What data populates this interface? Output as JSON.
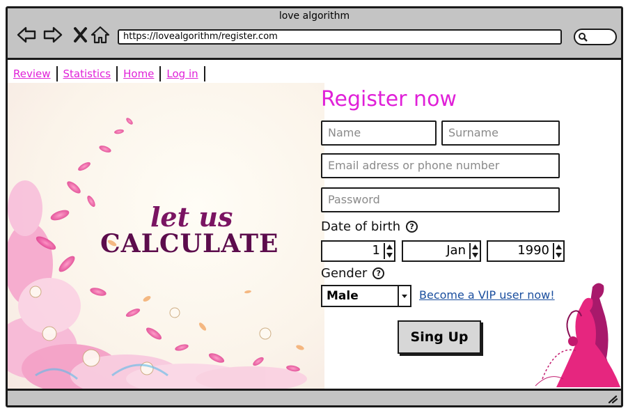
{
  "window": {
    "title": "love algorithm",
    "url": "https://lovealgorithm/register.com"
  },
  "nav_links": [
    "Review",
    "Statistics",
    "Home",
    "Log in"
  ],
  "hero": {
    "line1": "let us",
    "line2": "CALCULATE"
  },
  "form": {
    "title": "Register now",
    "name_placeholder": "Name",
    "surname_placeholder": "Surname",
    "email_placeholder": "Email adress or phone number",
    "password_placeholder": "Password",
    "dob_label": "Date of birth",
    "dob_day": "1",
    "dob_month": "Jan",
    "dob_year": "1990",
    "gender_label": "Gender",
    "gender_value": "Male",
    "vip_link": "Become a VIP user now!",
    "submit_label": "Sing Up"
  },
  "colors": {
    "accent_magenta": "#e020d8",
    "link_blue": "#1a4e9e",
    "chrome_gray": "#c4c4c4",
    "hero_plum": "#5c0c4c"
  }
}
